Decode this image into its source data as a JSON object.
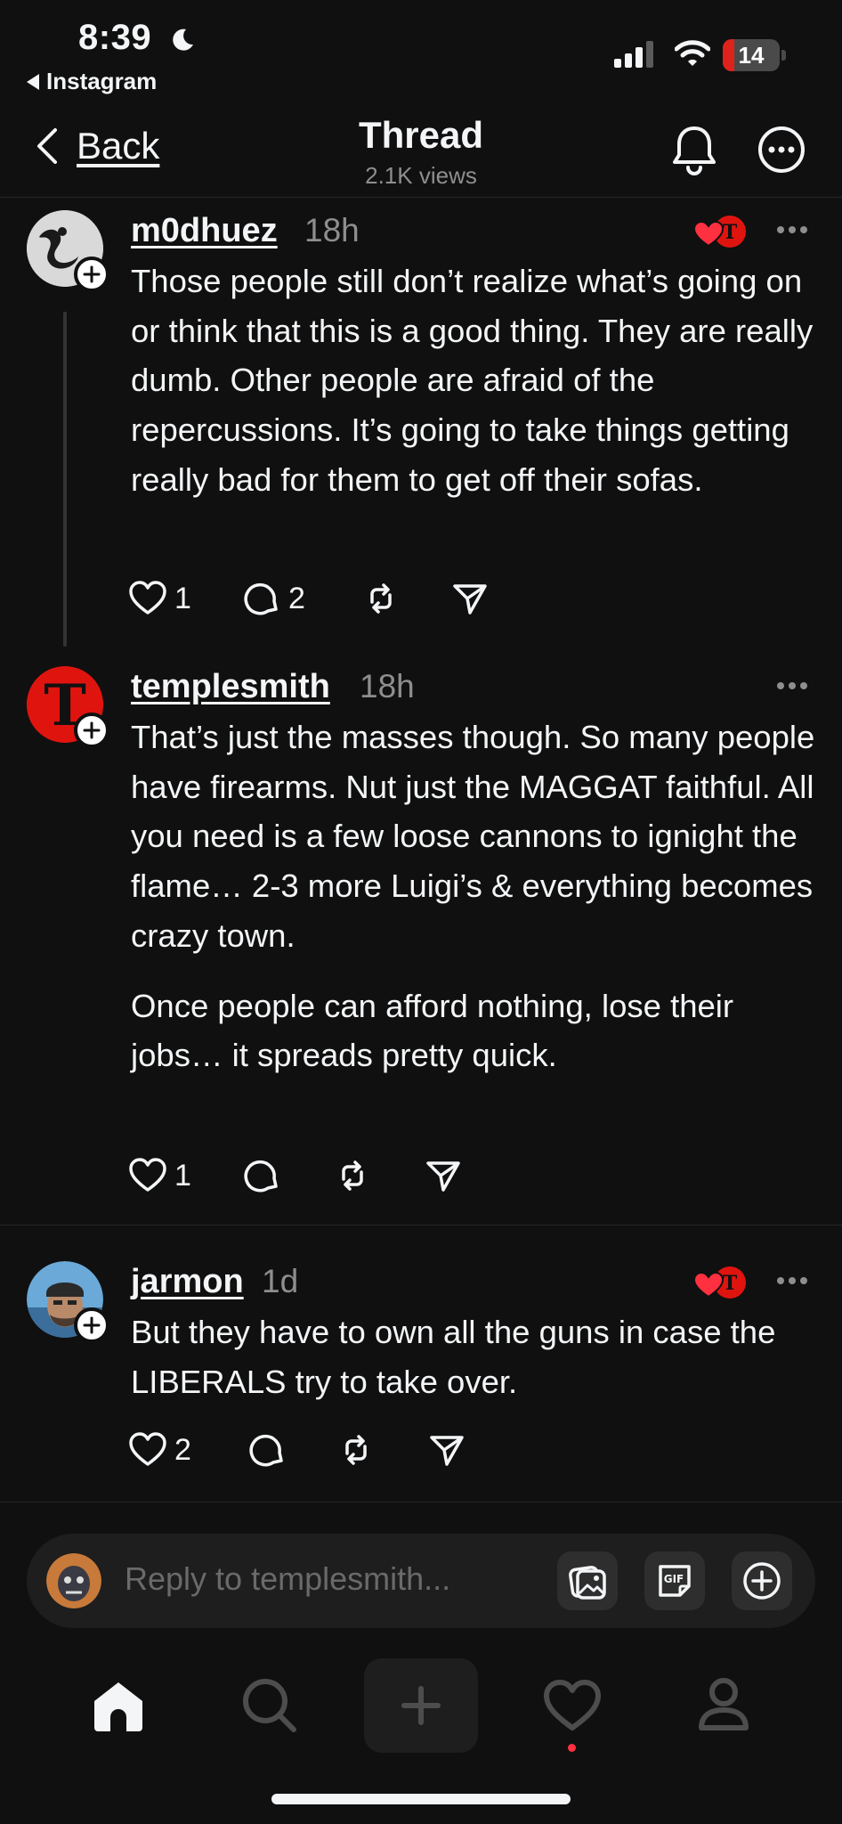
{
  "status_bar": {
    "time": "8:39",
    "back_app": "Instagram",
    "battery": "14",
    "battery_level": 0.14
  },
  "header": {
    "back_label": "Back",
    "title": "Thread",
    "views": "2.1K views"
  },
  "posts": [
    {
      "username": "m0dhuez",
      "time_ago": "18h",
      "paragraphs": [
        "Those people still don’t realize what’s going on or think that this is a good thing. They are really dumb. Other people are afraid of the repercussions. It’s going to take things getting really bad for them to get off their sofas."
      ],
      "likes": "1",
      "replies": "2",
      "liked_by_author": true
    },
    {
      "username": "templesmith",
      "time_ago": "18h",
      "paragraphs": [
        "That’s just the masses though. So many people have firearms. Nut just the MAGGAT faithful. All you need is a few loose cannons to ignight the flame… 2-3 more Luigi’s & everything becomes crazy town.",
        "Once people can afford nothing, lose their jobs… it spreads pretty quick."
      ],
      "likes": "1",
      "replies": "",
      "liked_by_author": false
    },
    {
      "username": "jarmon",
      "time_ago": "1d",
      "paragraphs": [
        "But they have to own all the guns in case the LIBERALS try to take over."
      ],
      "likes": "2",
      "replies": "",
      "liked_by_author": true
    }
  ],
  "reply_bar": {
    "placeholder": "Reply to templesmith..."
  },
  "tab_bar": {
    "active": "home",
    "activity_has_notification": true
  },
  "colors": {
    "background": "#101010",
    "text": "#f3f5f7",
    "secondary": "#8e8e8e",
    "accent_red": "#ff3040",
    "templesmith_avatar": "#e0140f"
  }
}
